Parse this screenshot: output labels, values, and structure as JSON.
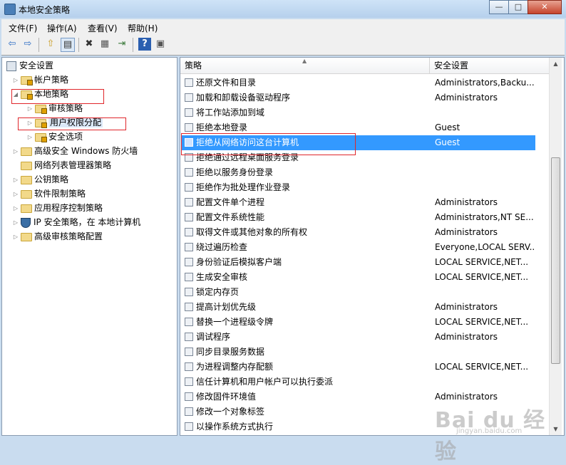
{
  "window": {
    "title": "本地安全策略",
    "controls": {
      "minimize": "—",
      "maximize": "□",
      "close": "✕"
    }
  },
  "menu": [
    "文件(F)",
    "操作(A)",
    "查看(V)",
    "帮助(H)"
  ],
  "toolbar": {
    "icons": [
      "back-icon",
      "forward-icon",
      "up-folder-icon",
      "show-tree-icon",
      "delete-icon",
      "properties-icon",
      "export-icon",
      "help-icon",
      "console-icon"
    ],
    "glyphs": {
      "back": "⇦",
      "forward": "⇨",
      "up": "⇧",
      "tree": "▤",
      "delete": "✖",
      "properties": "▦",
      "export": "⇥",
      "help": "?",
      "console": "▣"
    }
  },
  "tree": [
    {
      "label": "安全设置",
      "level": 0,
      "expander": ""
    },
    {
      "label": "帐户策略",
      "level": 1,
      "expander": "▷"
    },
    {
      "label": "本地策略",
      "level": 1,
      "expander": "◢"
    },
    {
      "label": "审核策略",
      "level": 2,
      "expander": "▷"
    },
    {
      "label": "用户权限分配",
      "level": 2,
      "expander": "▷"
    },
    {
      "label": "安全选项",
      "level": 2,
      "expander": "▷"
    },
    {
      "label": "高级安全 Windows 防火墙",
      "level": 1,
      "expander": "▷"
    },
    {
      "label": "网络列表管理器策略",
      "level": 1,
      "expander": ""
    },
    {
      "label": "公钥策略",
      "level": 1,
      "expander": "▷"
    },
    {
      "label": "软件限制策略",
      "level": 1,
      "expander": "▷"
    },
    {
      "label": "应用程序控制策略",
      "level": 1,
      "expander": "▷"
    },
    {
      "label": "IP 安全策略，在 本地计算机",
      "level": 1,
      "expander": "▷"
    },
    {
      "label": "高级审核策略配置",
      "level": 1,
      "expander": "▷"
    }
  ],
  "columns": {
    "policy": "策略",
    "setting": "安全设置",
    "sort_glyph": "▲"
  },
  "rows": [
    {
      "policy": "还原文件和目录",
      "setting": "Administrators,Backu..."
    },
    {
      "policy": "加载和卸载设备驱动程序",
      "setting": "Administrators"
    },
    {
      "policy": "将工作站添加到域",
      "setting": ""
    },
    {
      "policy": "拒绝本地登录",
      "setting": "Guest"
    },
    {
      "policy": "拒绝从网络访问这台计算机",
      "setting": "Guest"
    },
    {
      "policy": "拒绝通过远程桌面服务登录",
      "setting": ""
    },
    {
      "policy": "拒绝以服务身份登录",
      "setting": ""
    },
    {
      "policy": "拒绝作为批处理作业登录",
      "setting": ""
    },
    {
      "policy": "配置文件单个进程",
      "setting": "Administrators"
    },
    {
      "policy": "配置文件系统性能",
      "setting": "Administrators,NT SE..."
    },
    {
      "policy": "取得文件或其他对象的所有权",
      "setting": "Administrators"
    },
    {
      "policy": "绕过遍历检查",
      "setting": "Everyone,LOCAL SERV..."
    },
    {
      "policy": "身份验证后模拟客户端",
      "setting": "LOCAL SERVICE,NET..."
    },
    {
      "policy": "生成安全审核",
      "setting": "LOCAL SERVICE,NET..."
    },
    {
      "policy": "锁定内存页",
      "setting": ""
    },
    {
      "policy": "提高计划优先级",
      "setting": "Administrators"
    },
    {
      "policy": "替换一个进程级令牌",
      "setting": "LOCAL SERVICE,NET..."
    },
    {
      "policy": "调试程序",
      "setting": "Administrators"
    },
    {
      "policy": "同步目录服务数据",
      "setting": ""
    },
    {
      "policy": "为进程调整内存配额",
      "setting": "LOCAL SERVICE,NET..."
    },
    {
      "policy": "信任计算机和用户帐户可以执行委派",
      "setting": ""
    },
    {
      "policy": "修改固件环境值",
      "setting": "Administrators"
    },
    {
      "policy": "修改一个对象标签",
      "setting": ""
    },
    {
      "policy": "以操作系统方式执行",
      "setting": ""
    }
  ],
  "selected_row": 4,
  "scrollbar": {
    "up": "▲",
    "down": "▼"
  },
  "watermark": {
    "text": "Bai du 经验",
    "sub": "jingyan.baidu.com"
  },
  "colors": {
    "selection": "#3399ff",
    "highlight_box": "#e0262b"
  }
}
